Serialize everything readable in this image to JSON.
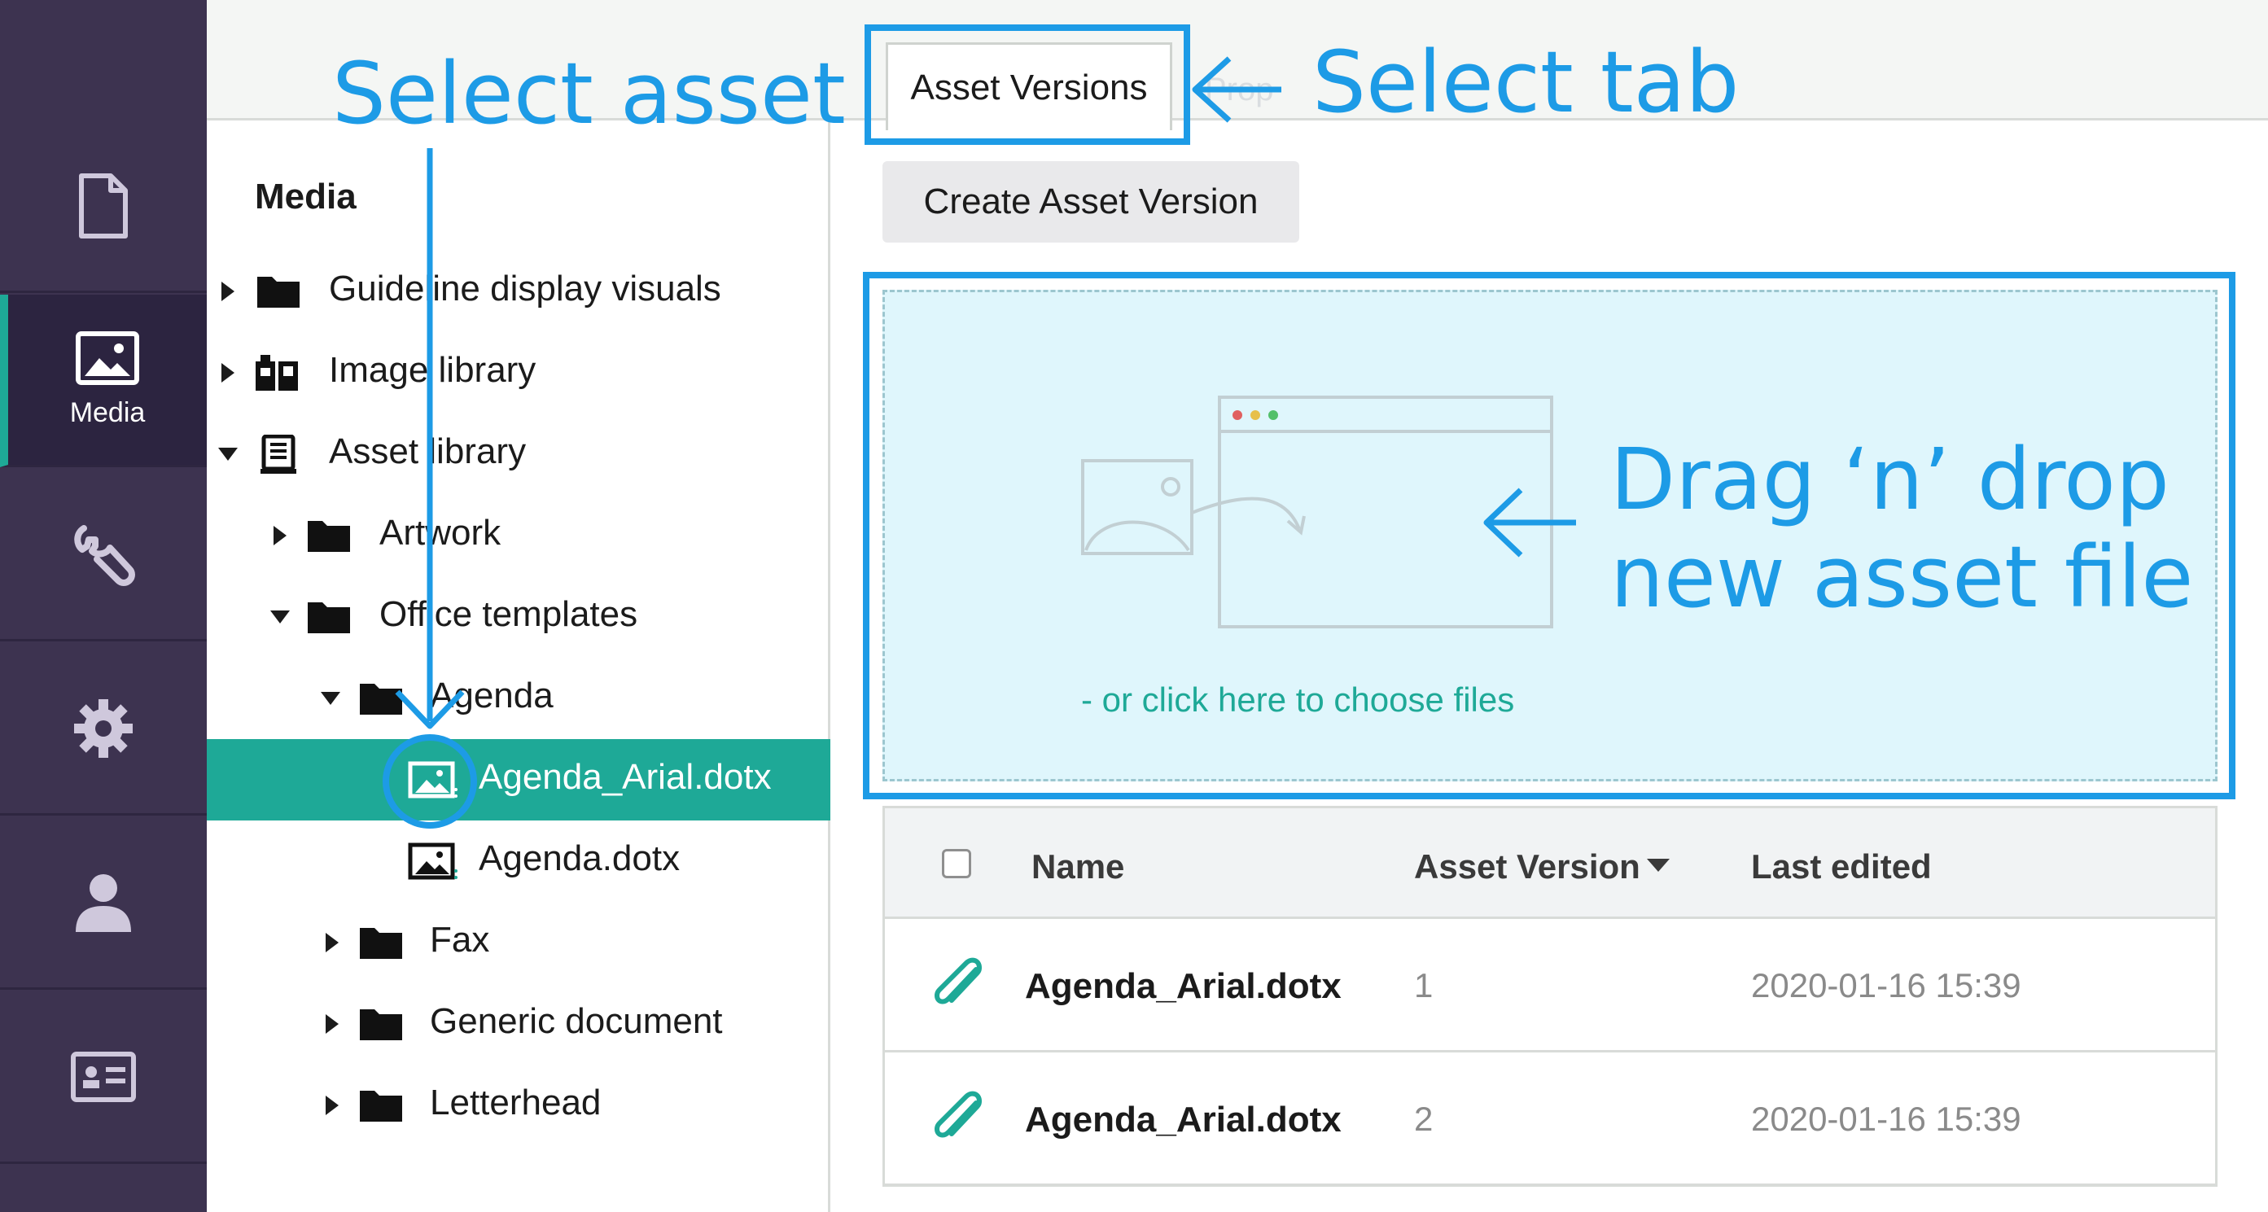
{
  "colors": {
    "rail_bg": "#3d3350",
    "accent_teal": "#1ea997",
    "annotation_blue": "#1d9be6",
    "dropzone_bg": "#dff6fc"
  },
  "rail": {
    "items": [
      {
        "icon": "document-icon",
        "label": ""
      },
      {
        "icon": "image-icon",
        "label": "Media",
        "active": true
      },
      {
        "icon": "wrench-icon",
        "label": ""
      },
      {
        "icon": "gear-icon",
        "label": ""
      },
      {
        "icon": "user-icon",
        "label": ""
      },
      {
        "icon": "contact-card-icon",
        "label": ""
      }
    ]
  },
  "tree": {
    "title": "Media",
    "items": [
      {
        "label": "Guideline display visuals",
        "expanded": false,
        "icon": "folder-icon"
      },
      {
        "label": "Image library",
        "expanded": false,
        "icon": "image-library-icon"
      },
      {
        "label": "Asset library",
        "expanded": true,
        "icon": "asset-library-icon"
      },
      {
        "label": "Artwork",
        "expanded": false,
        "icon": "folder-icon"
      },
      {
        "label": "Office templates",
        "expanded": true,
        "icon": "folder-icon"
      },
      {
        "label": "Agenda",
        "expanded": true,
        "icon": "folder-icon"
      },
      {
        "label": "Agenda_Arial.dotx",
        "selected": true,
        "icon": "asset-file-icon"
      },
      {
        "label": "Agenda.dotx",
        "icon": "asset-file-icon"
      },
      {
        "label": "Fax",
        "expanded": false,
        "icon": "folder-icon"
      },
      {
        "label": "Generic document",
        "expanded": false,
        "icon": "folder-icon"
      },
      {
        "label": "Letterhead",
        "expanded": false,
        "icon": "folder-icon"
      }
    ]
  },
  "tabs": {
    "active": "Asset Versions",
    "ghost": "Prop"
  },
  "actions": {
    "create": "Create Asset Version"
  },
  "dropzone": {
    "link": "- or click here to choose files"
  },
  "table": {
    "headers": {
      "name": "Name",
      "version": "Asset Version",
      "edited": "Last edited"
    },
    "rows": [
      {
        "name": "Agenda_Arial.dotx",
        "version": "1",
        "edited": "2020-01-16 15:39"
      },
      {
        "name": "Agenda_Arial.dotx",
        "version": "2",
        "edited": "2020-01-16 15:39"
      }
    ]
  },
  "annotations": {
    "select_asset": "Select asset",
    "select_tab": "Select tab",
    "drag_line1": "Drag ‘n’ drop",
    "drag_line2": "new asset file"
  }
}
